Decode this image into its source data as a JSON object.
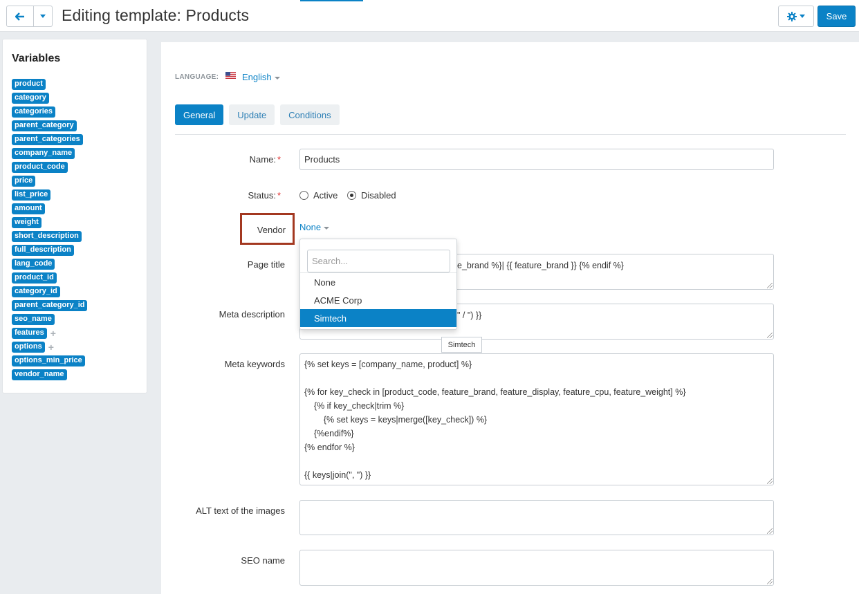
{
  "header": {
    "title": "Editing template: Products",
    "save_label": "Save"
  },
  "sidebar": {
    "title": "Variables",
    "variables": [
      {
        "name": "product",
        "expandable": false
      },
      {
        "name": "category",
        "expandable": false
      },
      {
        "name": "categories",
        "expandable": false
      },
      {
        "name": "parent_category",
        "expandable": false
      },
      {
        "name": "parent_categories",
        "expandable": false
      },
      {
        "name": "company_name",
        "expandable": false
      },
      {
        "name": "product_code",
        "expandable": false
      },
      {
        "name": "price",
        "expandable": false
      },
      {
        "name": "list_price",
        "expandable": false
      },
      {
        "name": "amount",
        "expandable": false
      },
      {
        "name": "weight",
        "expandable": false
      },
      {
        "name": "short_description",
        "expandable": false
      },
      {
        "name": "full_description",
        "expandable": false
      },
      {
        "name": "lang_code",
        "expandable": false
      },
      {
        "name": "product_id",
        "expandable": false
      },
      {
        "name": "category_id",
        "expandable": false
      },
      {
        "name": "parent_category_id",
        "expandable": false
      },
      {
        "name": "seo_name",
        "expandable": false
      },
      {
        "name": "features",
        "expandable": true
      },
      {
        "name": "options",
        "expandable": true
      },
      {
        "name": "options_min_price",
        "expandable": false
      },
      {
        "name": "vendor_name",
        "expandable": false
      }
    ]
  },
  "language": {
    "label": "LANGUAGE:",
    "value": "English"
  },
  "tabs": [
    {
      "label": "General",
      "active": true
    },
    {
      "label": "Update",
      "active": false
    },
    {
      "label": "Conditions",
      "active": false
    }
  ],
  "form": {
    "name": {
      "label": "Name:",
      "value": "Products"
    },
    "status": {
      "label": "Status:",
      "options": [
        "Active",
        "Disabled"
      ],
      "selected": "Disabled"
    },
    "vendor": {
      "label": "Vendor",
      "value": "None"
    },
    "page_title": {
      "label": "Page title",
      "visible_value": "e_brand %}| {{ feature_brand }} {% endif %}"
    },
    "meta_description": {
      "label": "Meta description",
      "visible_value": "\" / \") }}"
    },
    "meta_keywords": {
      "label": "Meta keywords",
      "value": "{% set keys = [company_name, product] %}\n\n{% for key_check in [product_code, feature_brand, feature_display, feature_cpu, feature_weight] %}\n    {% if key_check|trim %}\n        {% set keys = keys|merge([key_check]) %}\n    {%endif%}\n{% endfor %}\n\n{{ keys|join(\", \") }}"
    },
    "alt_text": {
      "label": "ALT text of the images",
      "value": ""
    },
    "seo_name": {
      "label": "SEO name",
      "value": ""
    }
  },
  "vendor_dropdown": {
    "search_placeholder": "Search...",
    "options": [
      "None",
      "ACME Corp",
      "Simtech"
    ],
    "highlighted": "Simtech",
    "tooltip": "Simtech"
  },
  "colors": {
    "accent": "#0b82c6",
    "highlight_box": "#a33820"
  }
}
